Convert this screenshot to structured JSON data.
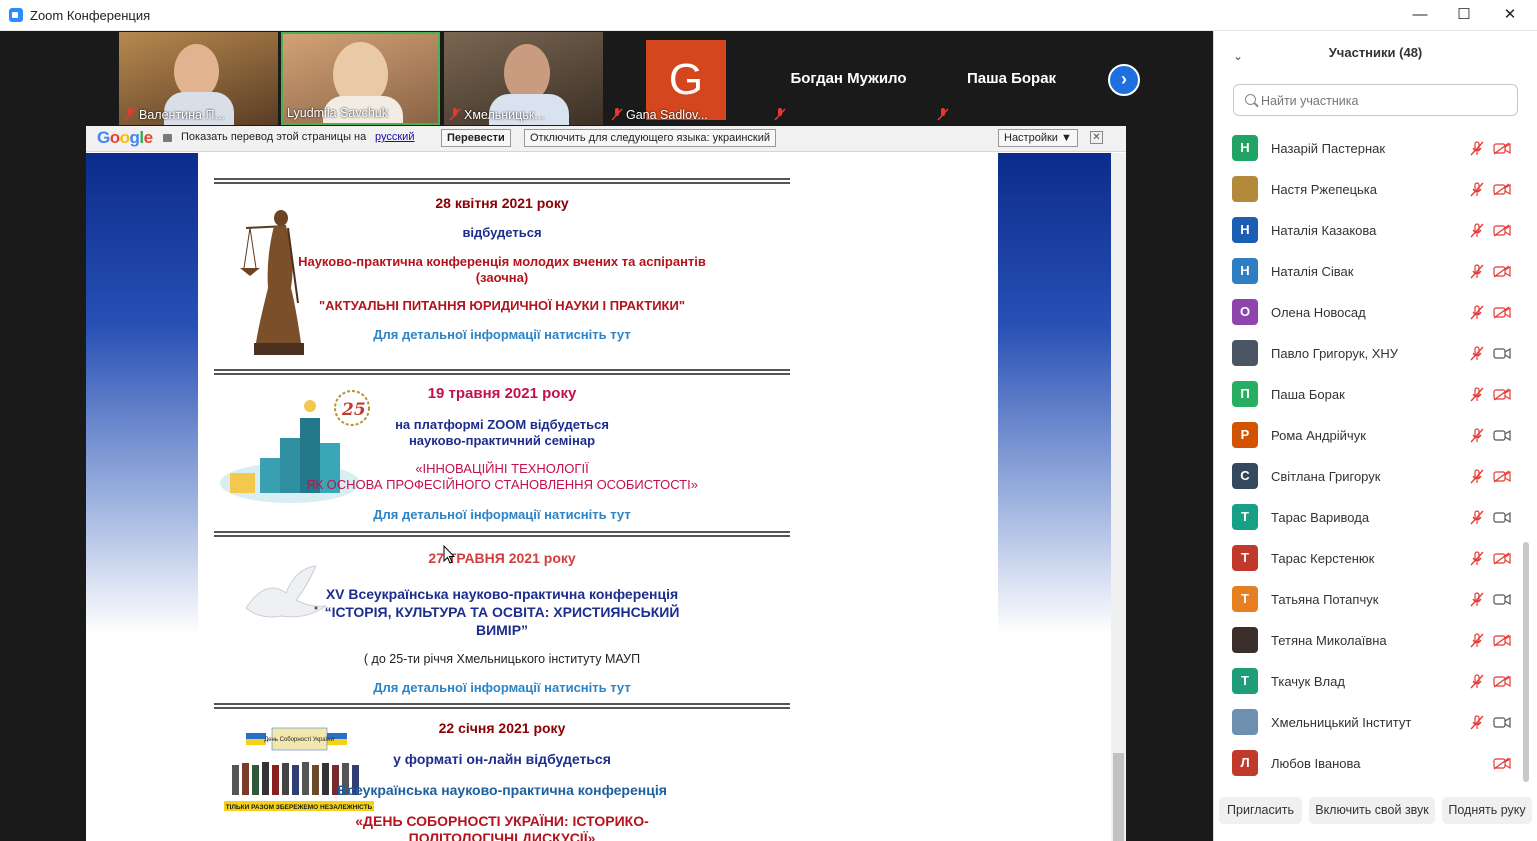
{
  "window": {
    "title": "Zoom Конференция",
    "controls": [
      "—",
      "☐",
      "✕"
    ]
  },
  "video_strip": [
    {
      "name": "Валентина П...",
      "muted": true,
      "bg": "#8a6a4a"
    },
    {
      "name": "Lyudmila Savchuk",
      "muted": false,
      "bg": "#c9a27a"
    },
    {
      "name": "Хмельницьк...",
      "muted": true,
      "bg": "#6d5b4b"
    },
    {
      "name": "Gana Sadlov...",
      "muted": true,
      "avatar_letter": "G"
    },
    {
      "name": "Богдан Мужило",
      "muted": true
    },
    {
      "name": "Паша Борак",
      "muted": true
    }
  ],
  "next_button": "›",
  "translate_bar": {
    "logo": "Google",
    "prompt": "Показать перевод этой страницы на",
    "language": "русский",
    "translate_button": "Перевести",
    "disable_button": "Отключить для следующего языка: украинский",
    "settings_button": "Настройки ▼",
    "close": "✕"
  },
  "events": [
    {
      "lines": [
        "28 квітня 2021 року",
        "відбудеться",
        "Науково-практична конференція молодих вчених та аспірантів",
        "(заочна)",
        "\"АКТУАЛЬНІ ПИТАННЯ ЮРИДИЧНОЇ НАУКИ І ПРАКТИКИ\"",
        "Для детальної інформації натисніть тут"
      ]
    },
    {
      "lines": [
        "19  травня 2021 року",
        "на платформі ZOOM відбудеться",
        "науково-практичний семінар",
        "«ІННОВАЦІЙНІ ТЕХНОЛОГІЇ",
        "ЯК ОСНОВА ПРОФЕСІЙНОГО СТАНОВЛЕННЯ ОСОБИСТОСТІ»",
        "Для детальної інформації натисніть тут"
      ],
      "badge": "25"
    },
    {
      "lines": [
        "27 ТРАВНЯ 2021 року",
        "XV  Всеукраїнська науково-практична конференція",
        "“ІСТОРІЯ, КУЛЬТУРА ТА ОСВІТА: ХРИСТИЯНСЬКИЙ",
        "ВИМІР”",
        "( до 25-ти річчя  Хмельницького інституту МАУП",
        "Для детальної інформації натисніть тут"
      ]
    },
    {
      "lines": [
        "22 січня 2021 року",
        "у форматі он-лайн відбудеться",
        "Всеукраїнська науково-практична конференція",
        "«ДЕНЬ СОБОРНОСТІ УКРАЇНИ: ІСТОРИКО-",
        "ПОЛІТОЛОГІЧНІ ДИСКУСІЇ»"
      ],
      "poster_title": "День Соборності України",
      "poster_slogan": "ТІЛЬКИ РАЗОМ  ЗБЕРЕЖЕМО НЕЗАЛЕЖНІСТЬ"
    }
  ],
  "participants_panel": {
    "title": "Участники (48)",
    "search_placeholder": "Найти участника",
    "participants": [
      {
        "name": "Назарій Пастернак",
        "initial": "Н",
        "color": "#21a366",
        "video": false
      },
      {
        "name": "Настя Ржепецька",
        "initial": "",
        "color": "#b38a3c",
        "video": false,
        "photo": true
      },
      {
        "name": "Наталія Казакова",
        "initial": "Н",
        "color": "#1a5fb4",
        "video": false
      },
      {
        "name": "Наталія Сівак",
        "initial": "Н",
        "color": "#2d7fc1",
        "video": false
      },
      {
        "name": "Олена Новосад",
        "initial": "О",
        "color": "#8e44ad",
        "video": false
      },
      {
        "name": "Павло Григорук, ХНУ",
        "initial": "",
        "color": "#4a5663",
        "video": true,
        "photo": true
      },
      {
        "name": "Паша Борак",
        "initial": "П",
        "color": "#27ae60",
        "video": false
      },
      {
        "name": "Рома Андрійчук",
        "initial": "Р",
        "color": "#d35400",
        "video": true
      },
      {
        "name": "Світлана Григорук",
        "initial": "С",
        "color": "#34495e",
        "video": false
      },
      {
        "name": "Тарас Варивода",
        "initial": "Т",
        "color": "#16a085",
        "video": true
      },
      {
        "name": "Тарас Керстенюк",
        "initial": "Т",
        "color": "#c0392b",
        "video": false
      },
      {
        "name": "Татьяна Потапчук",
        "initial": "Т",
        "color": "#e67e22",
        "video": true
      },
      {
        "name": "Тетяна Миколаївна",
        "initial": "",
        "color": "#3a2f2a",
        "video": false,
        "photo": true
      },
      {
        "name": "Ткачук Влад",
        "initial": "Т",
        "color": "#1e9e78",
        "video": false
      },
      {
        "name": "Хмельницький Інститут",
        "initial": "",
        "color": "#6f8fb0",
        "video": true,
        "photo": true
      },
      {
        "name": "Любов Іванова",
        "initial": "Л",
        "color": "#c0392b",
        "video": false,
        "no_mic": true
      }
    ],
    "buttons": [
      "Пригласить",
      "Включить свой звук",
      "Поднять руку"
    ]
  }
}
